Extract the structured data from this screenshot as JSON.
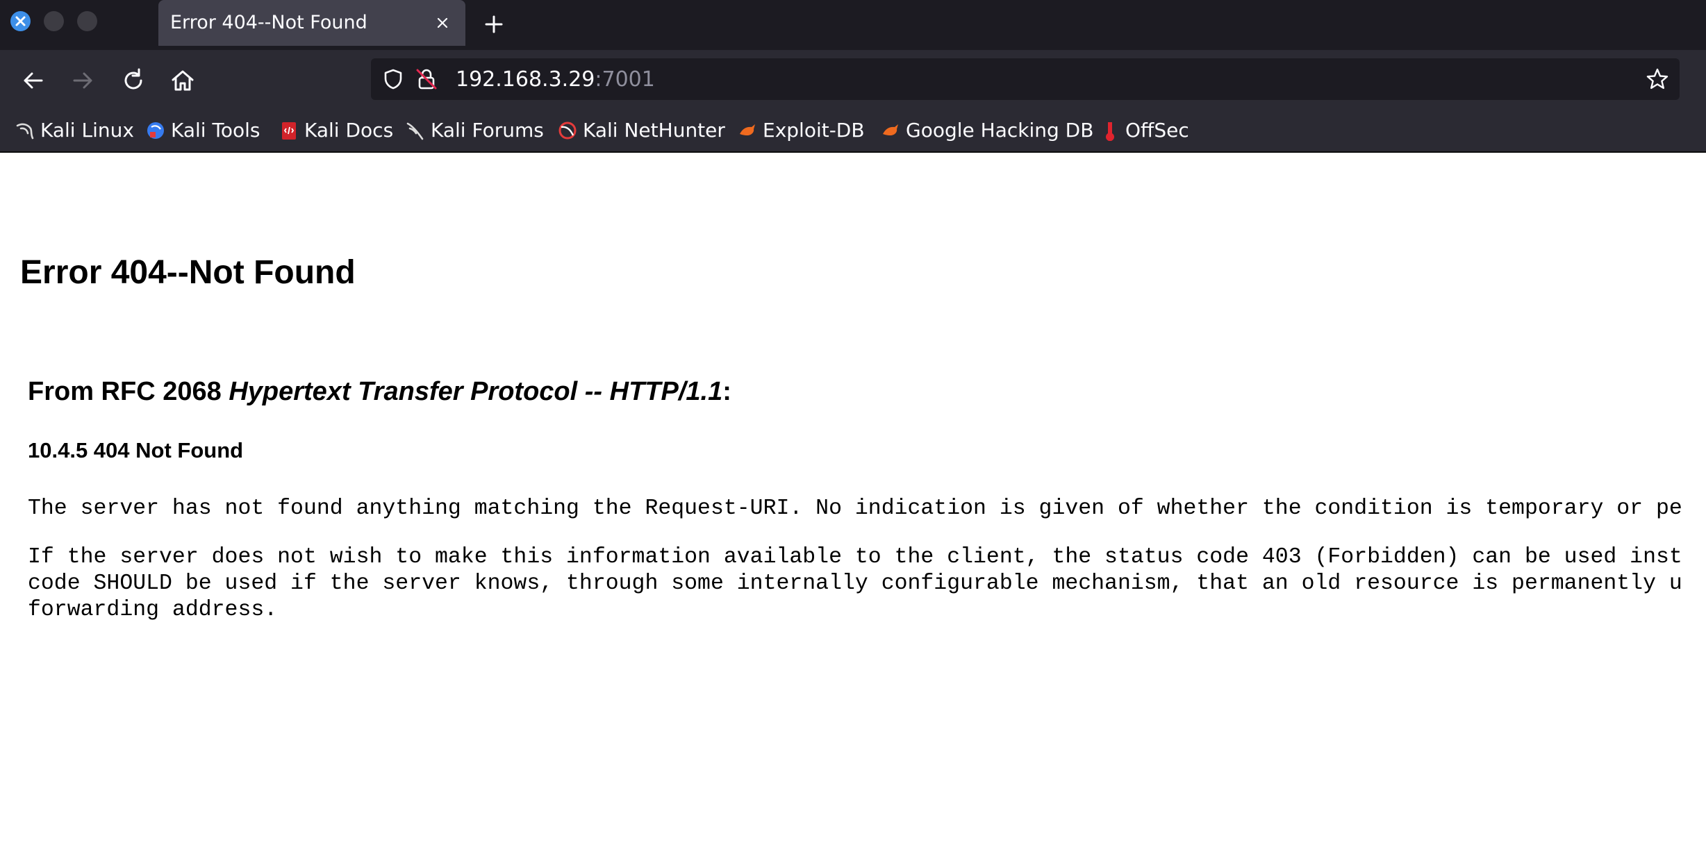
{
  "browser": {
    "tab": {
      "title": "Error 404--Not Found"
    },
    "url": {
      "host": "192.168.3.29",
      "port": ":7001"
    },
    "bookmarks": [
      {
        "label": "Kali Linux",
        "icon": "kali-dragon-icon"
      },
      {
        "label": "Kali Tools",
        "icon": "kali-tools-icon"
      },
      {
        "label": "Kali Docs",
        "icon": "kali-docs-icon"
      },
      {
        "label": "Kali Forums",
        "icon": "kali-forums-icon"
      },
      {
        "label": "Kali NetHunter",
        "icon": "nethunter-icon"
      },
      {
        "label": "Exploit-DB",
        "icon": "exploit-db-icon"
      },
      {
        "label": "Google Hacking DB",
        "icon": "ghdb-icon"
      },
      {
        "label": "OffSec",
        "icon": "offsec-icon"
      }
    ]
  },
  "page": {
    "heading": "Error 404--Not Found",
    "rfc_prefix": "From RFC 2068 ",
    "rfc_title": "Hypertext Transfer Protocol -- HTTP/1.1",
    "rfc_suffix": ":",
    "section": "10.4.5 404 Not Found",
    "para1": "The server has not found anything matching the Request-URI. No indication is given of whether the condition is temporary or pe",
    "para2_line1": "If the server does not wish to make this information available to the client, the status code 403 (Forbidden) can be used inst",
    "para2_line2": "code SHOULD be used if the server knows, through some internally configurable mechanism, that an old resource is permanently u",
    "para2_line3": "forwarding address."
  },
  "colors": {
    "chrome_dark": "#1c1b22",
    "toolbar": "#2b2a33",
    "active_tab": "#42414d",
    "accent_blue": "#3d8fe8"
  }
}
